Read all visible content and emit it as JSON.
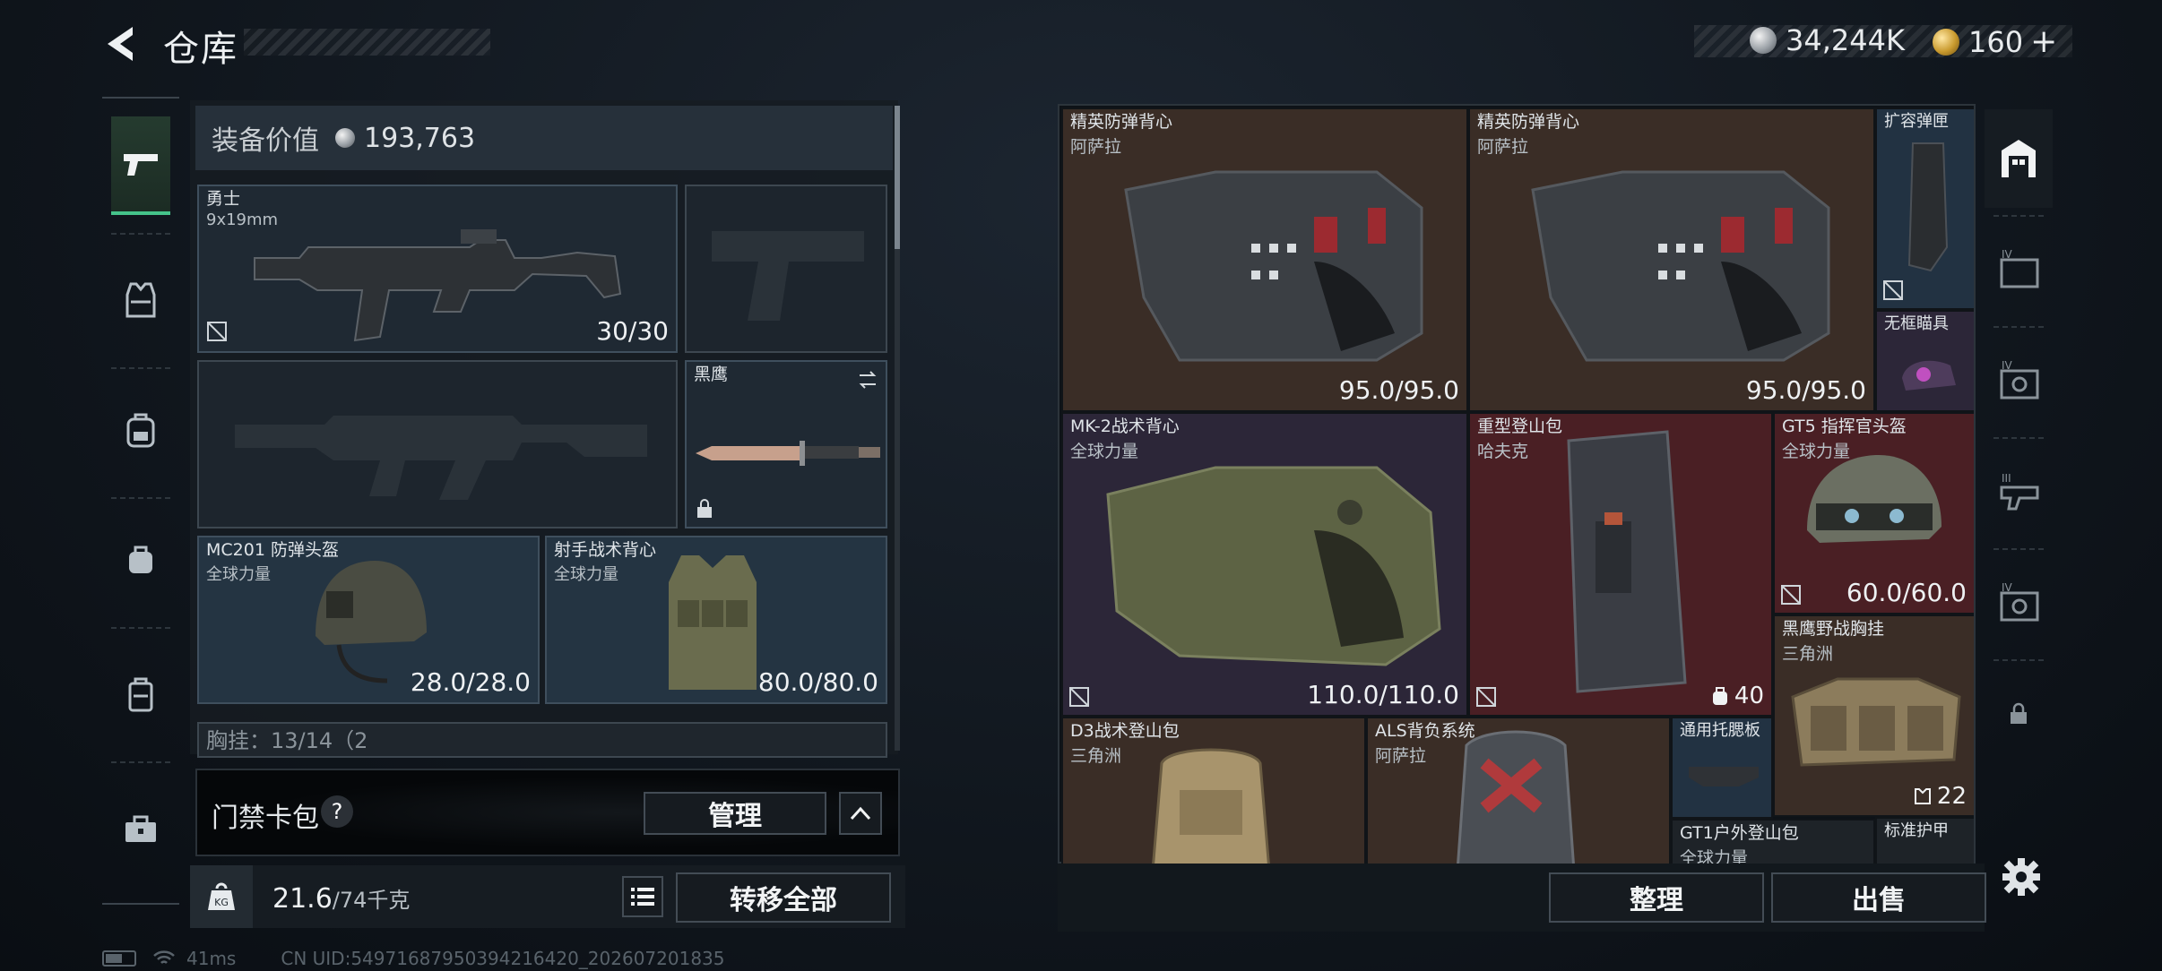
{
  "header": {
    "title": "仓库",
    "silver": "34,244K",
    "gold": "160",
    "gold_plus": "+"
  },
  "sidebar": {
    "tabs": [
      {
        "name": "pistol-icon",
        "active": true
      },
      {
        "name": "vest-icon",
        "active": false
      },
      {
        "name": "backpack-icon",
        "active": false
      },
      {
        "name": "backpack-small-icon",
        "active": false
      },
      {
        "name": "case-icon",
        "active": false
      },
      {
        "name": "toolbox-icon",
        "active": false
      }
    ]
  },
  "loadout": {
    "value_label": "装备价值",
    "value": "193,763",
    "primary": {
      "name": "勇士",
      "caliber": "9x19mm",
      "ammo": "30/30"
    },
    "knife": {
      "name": "黑鹰"
    },
    "helmet": {
      "name": "MC201 防弹头盔",
      "brand": "全球力量",
      "durability": "28.0/28.0"
    },
    "vest": {
      "name": "射手战术背心",
      "brand": "全球力量",
      "durability": "80.0/80.0"
    },
    "chest_partial": "胸挂：13/14（2"
  },
  "card_pack": {
    "label": "门禁卡包",
    "help": "?",
    "manage": "管理"
  },
  "weight": {
    "current": "21.6",
    "max": "/74千克",
    "transfer_all": "转移全部"
  },
  "status_bar": {
    "ping": "41ms",
    "uid": "CN UID:54971687950394216420_202607201835"
  },
  "stash": {
    "items": [
      {
        "name": "精英防弹背心",
        "brand": "阿萨拉",
        "value": "95.0/95.0"
      },
      {
        "name": "精英防弹背心",
        "brand": "阿萨拉",
        "value": "95.0/95.0"
      },
      {
        "name": "扩容弹匣",
        "brand": "",
        "value": ""
      },
      {
        "name": "无框瞄具",
        "brand": "",
        "value": ""
      },
      {
        "name": "MK-2战术背心",
        "brand": "全球力量",
        "value": "110.0/110.0"
      },
      {
        "name": "重型登山包",
        "brand": "哈夫克",
        "value": "40"
      },
      {
        "name": "GT5 指挥官头盔",
        "brand": "全球力量",
        "value": "60.0/60.0"
      },
      {
        "name": "黑鹰野战胸挂",
        "brand": "三角洲",
        "value": "22"
      },
      {
        "name": "D3战术登山包",
        "brand": "三角洲",
        "value": ""
      },
      {
        "name": "ALS背负系统",
        "brand": "阿萨拉",
        "value": ""
      },
      {
        "name": "通用托腮板",
        "brand": "",
        "value": ""
      },
      {
        "name": "GT1户外登山包",
        "brand": "全球力量",
        "value": ""
      },
      {
        "name": "标准护甲",
        "brand": "",
        "value": ""
      }
    ],
    "sort": "整理",
    "sell": "出售"
  },
  "right_rail": {
    "tabs": [
      "stash-home-icon",
      "stash-iv-icon",
      "stash-iv-icon",
      "stash-iii-icon",
      "stash-iv-icon",
      "lock-icon"
    ]
  }
}
